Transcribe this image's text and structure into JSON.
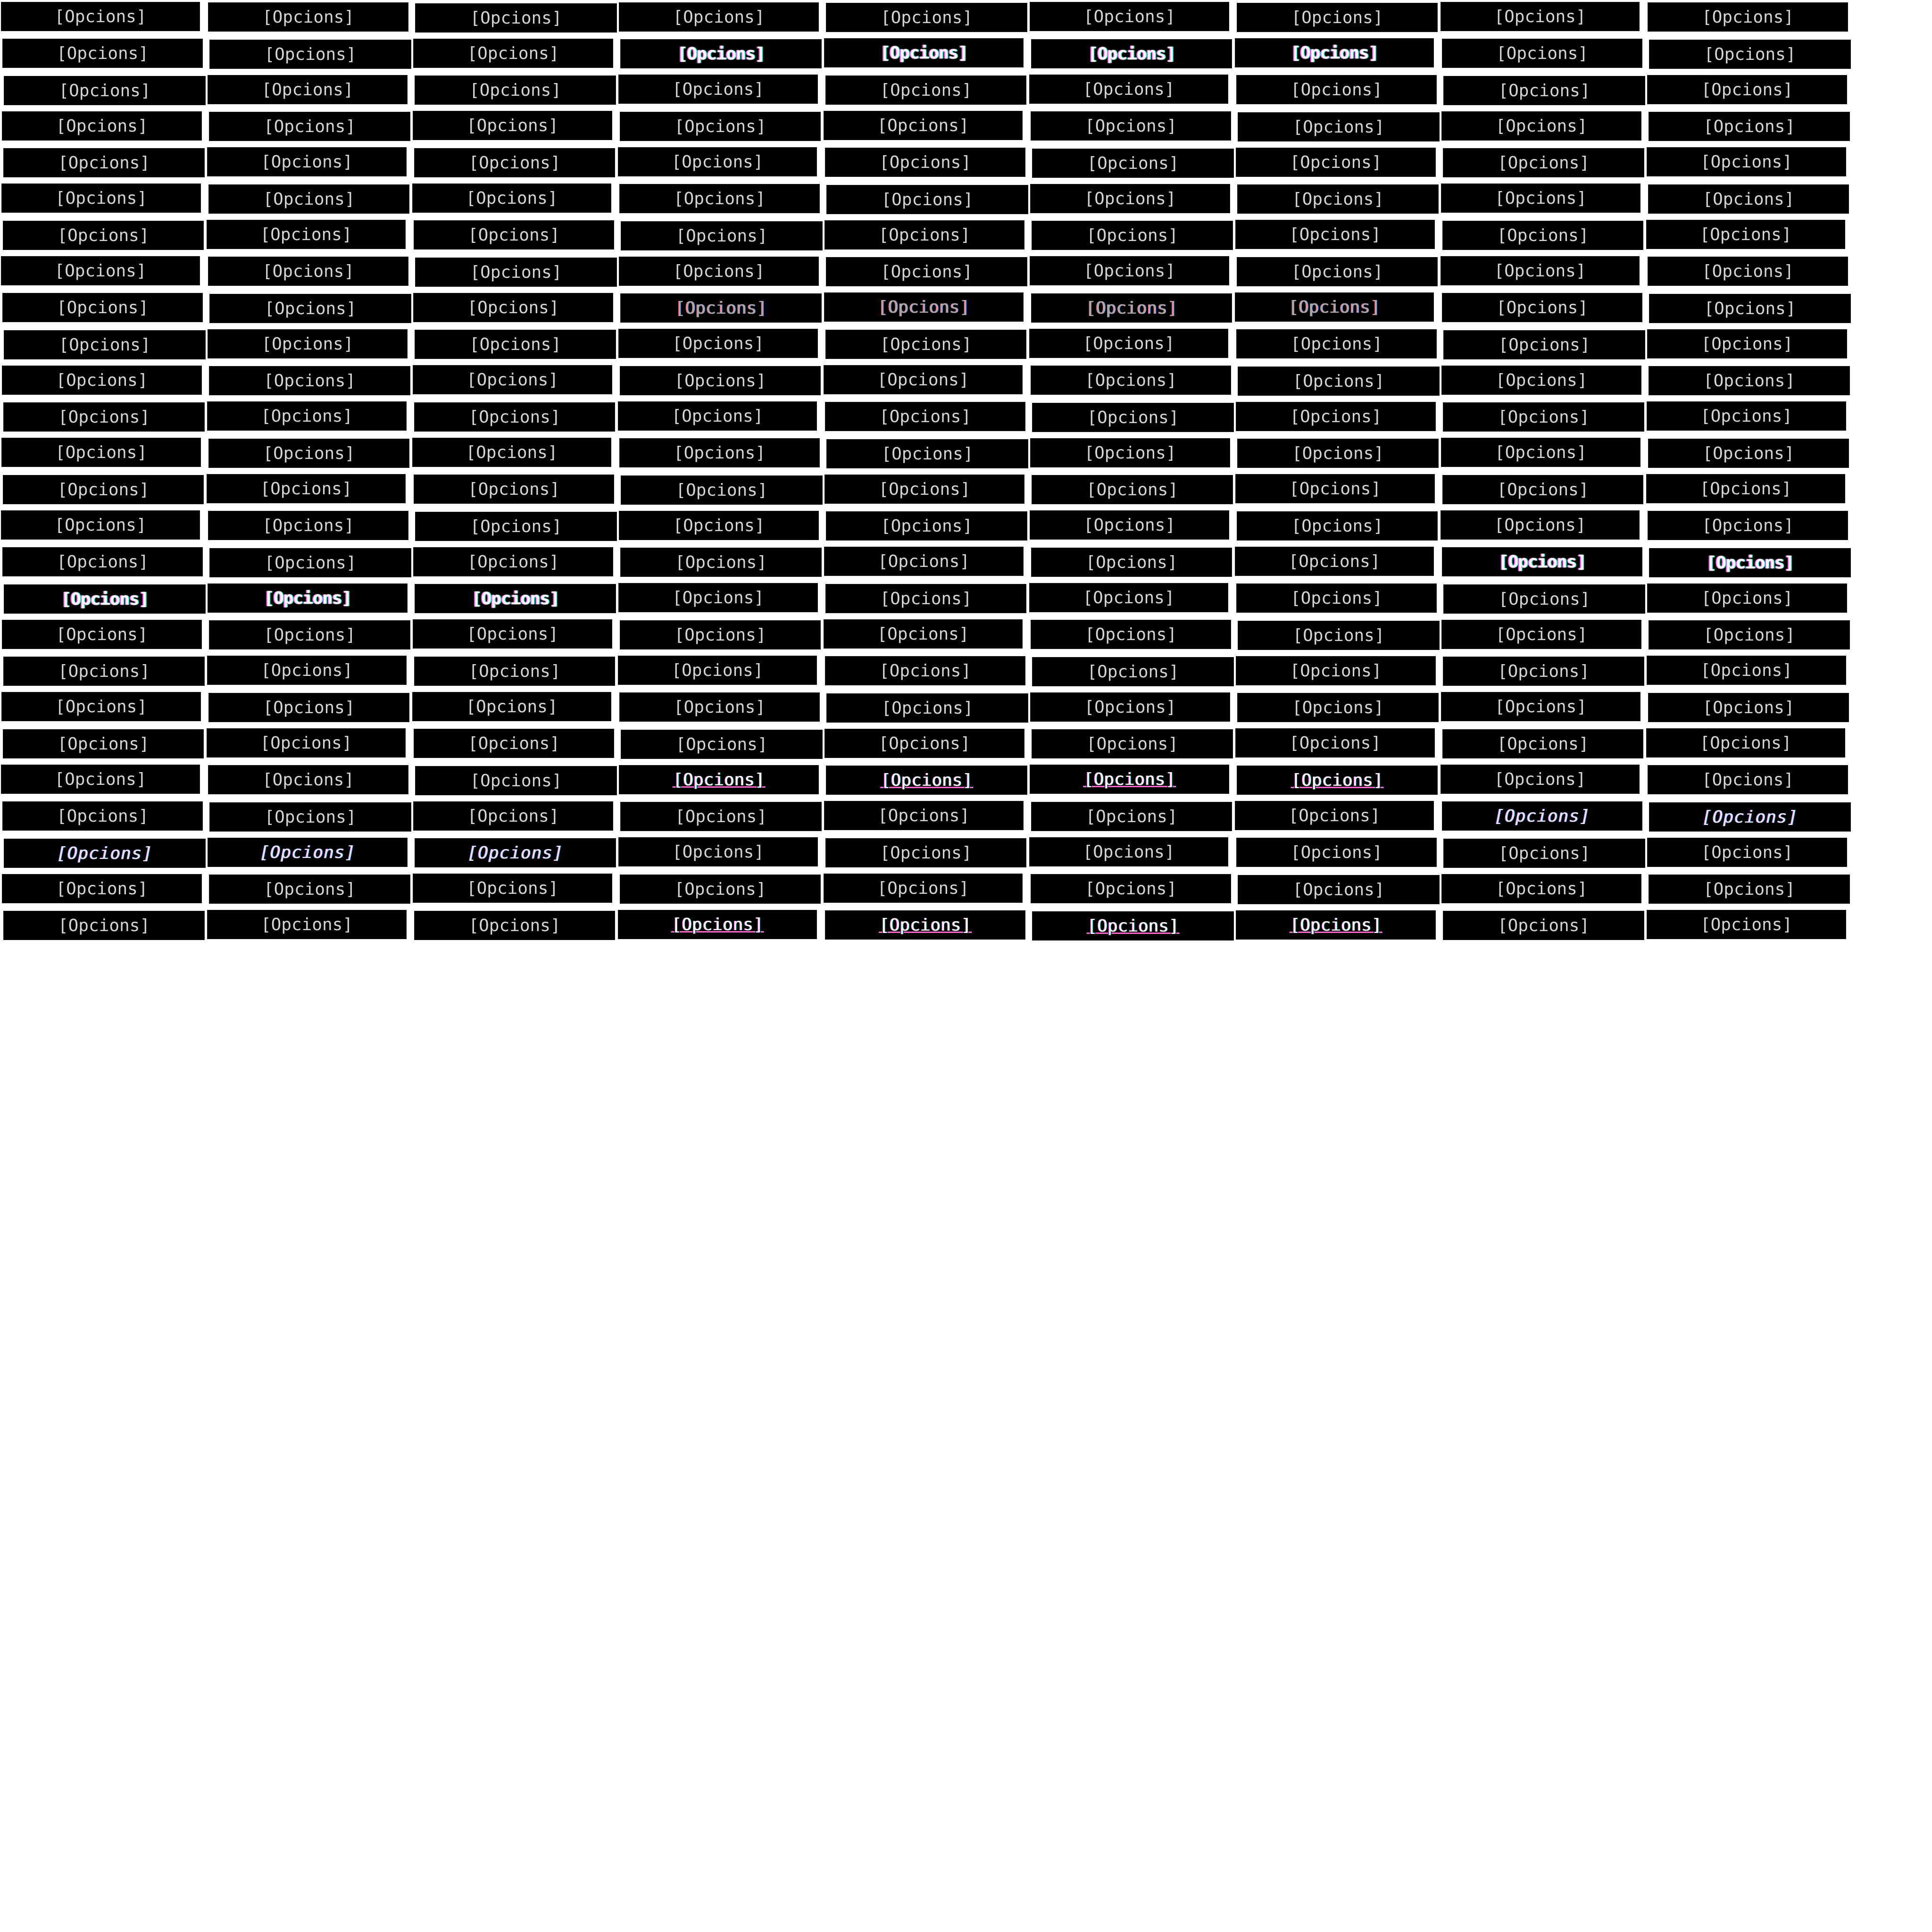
{
  "buttons": {
    "label": "[Opcions]",
    "rows": 26,
    "cols": 9
  },
  "glitches": {
    "bold": [
      [
        1,
        3
      ],
      [
        1,
        4
      ],
      [
        1,
        5
      ],
      [
        1,
        6
      ],
      [
        15,
        7
      ],
      [
        15,
        8
      ],
      [
        16,
        0
      ],
      [
        16,
        1
      ],
      [
        16,
        2
      ]
    ],
    "dim": [
      [
        8,
        3
      ],
      [
        8,
        4
      ],
      [
        8,
        5
      ],
      [
        8,
        6
      ]
    ],
    "under": [
      [
        21,
        3
      ],
      [
        21,
        4
      ],
      [
        21,
        5
      ],
      [
        21,
        6
      ],
      [
        25,
        3
      ],
      [
        25,
        4
      ],
      [
        25,
        5
      ],
      [
        25,
        6
      ]
    ],
    "italic": [
      [
        22,
        7
      ],
      [
        22,
        8
      ],
      [
        23,
        0
      ],
      [
        23,
        1
      ],
      [
        23,
        2
      ]
    ]
  }
}
